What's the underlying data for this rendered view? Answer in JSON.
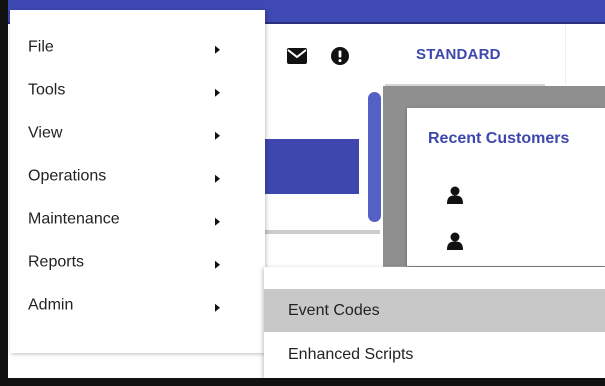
{
  "menu": {
    "items": [
      {
        "label": "File"
      },
      {
        "label": "Tools"
      },
      {
        "label": "View"
      },
      {
        "label": "Operations"
      },
      {
        "label": "Maintenance"
      },
      {
        "label": "Reports"
      },
      {
        "label": "Admin"
      }
    ]
  },
  "submenu": {
    "items": [
      {
        "label": "Event Codes"
      },
      {
        "label": "Enhanced Scripts"
      }
    ]
  },
  "toolbar": {
    "icons": [
      "envelope-icon",
      "exclamation-icon"
    ]
  },
  "tabs": [
    {
      "label": "STANDARD"
    }
  ],
  "card": {
    "title": "Recent Customers"
  },
  "colors": {
    "accent": "#3d47ad",
    "topbar": "#3f49b3",
    "highlight": "#c8c8c8"
  }
}
